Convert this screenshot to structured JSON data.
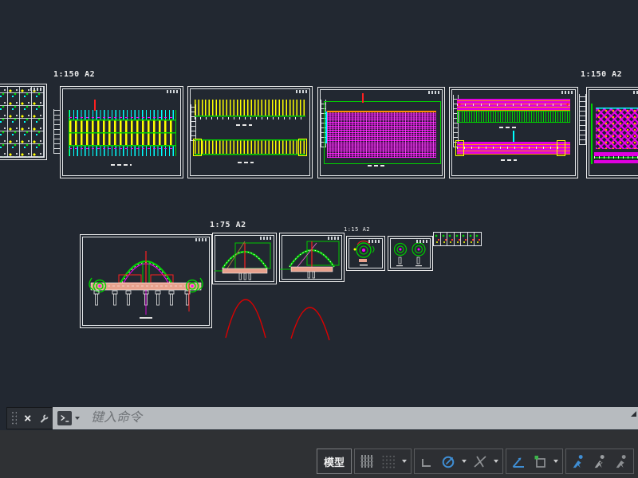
{
  "window": {
    "background": "#222831",
    "bottom_bar_background": "#2f3134"
  },
  "canvas": {
    "scale_labels": [
      {
        "text": "1:150 A2"
      },
      {
        "text": "1:150 A2"
      },
      {
        "text": "1:75 A2"
      },
      {
        "text": "1:15 A2"
      }
    ],
    "palette": {
      "frame_border": "#ededed",
      "cad_yellow": "#ffff00",
      "cad_cyan": "#00ffff",
      "cad_green": "#00d400",
      "cad_magenta": "#ff00ff",
      "cad_red": "#ff2020",
      "cad_orange": "#ff8c00",
      "cad_salmon": "#e8a18d",
      "arc_red": "#dd0000"
    }
  },
  "command_bar": {
    "placeholder": "键入命令",
    "icons": [
      "drag-grip",
      "close",
      "customize-wrench",
      "command-prompt",
      "recent-commands-caret"
    ]
  },
  "status_bar": {
    "model_button_label": "模型",
    "icons": [
      "grid-display",
      "snap-mode",
      "snap-caret",
      "ortho-mode",
      "polar-tracking",
      "polar-caret",
      "isometric-drafting",
      "isometric-caret",
      "object-snap-tracking",
      "object-snap",
      "object-snap-caret",
      "annotation-visibility",
      "annotation-autoscale",
      "annotation-scale"
    ],
    "accent_blue": "#3f8ed4",
    "osnap_green": "#3cb54a"
  }
}
